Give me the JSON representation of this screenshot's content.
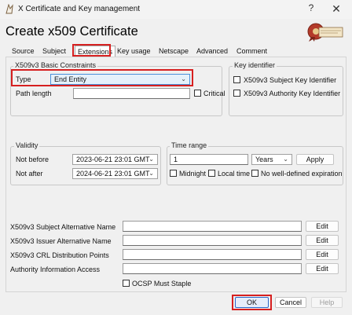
{
  "window": {
    "title": "X Certificate and Key management",
    "help_glyph": "?",
    "close_glyph": "✕"
  },
  "heading": "Create x509 Certificate",
  "tabs": [
    "Source",
    "Subject",
    "Extensions",
    "Key usage",
    "Netscape",
    "Advanced",
    "Comment"
  ],
  "basic_constraints": {
    "title": "X509v3 Basic Constraints",
    "type_label": "Type",
    "type_value": "End Entity",
    "path_length_label": "Path length",
    "path_length_value": "",
    "critical_label": "Critical"
  },
  "key_identifier": {
    "title": "Key identifier",
    "subject_label": "X509v3 Subject Key Identifier",
    "authority_label": "X509v3 Authority Key Identifier"
  },
  "validity": {
    "title": "Validity",
    "not_before_label": "Not before",
    "not_before_value": "2023-06-21 23:01 GMT",
    "not_after_label": "Not after",
    "not_after_value": "2024-06-21 23:01 GMT"
  },
  "time_range": {
    "title": "Time range",
    "amount": "1",
    "unit": "Years",
    "apply_label": "Apply",
    "midnight_label": "Midnight",
    "local_time_label": "Local time",
    "no_expiration_label": "No well-defined expiration"
  },
  "extensions": [
    {
      "label": "X509v3 Subject Alternative Name",
      "value": "",
      "button": "Edit"
    },
    {
      "label": "X509v3 Issuer Alternative Name",
      "value": "",
      "button": "Edit"
    },
    {
      "label": "X509v3 CRL Distribution Points",
      "value": "",
      "button": "Edit"
    },
    {
      "label": "Authority Information Access",
      "value": "",
      "button": "Edit"
    }
  ],
  "ocsp_label": "OCSP Must Staple",
  "buttons": {
    "ok": "OK",
    "cancel": "Cancel",
    "help": "Help"
  },
  "colors": {
    "highlight_box": "#d62020",
    "selection": "#e5f1fb"
  }
}
